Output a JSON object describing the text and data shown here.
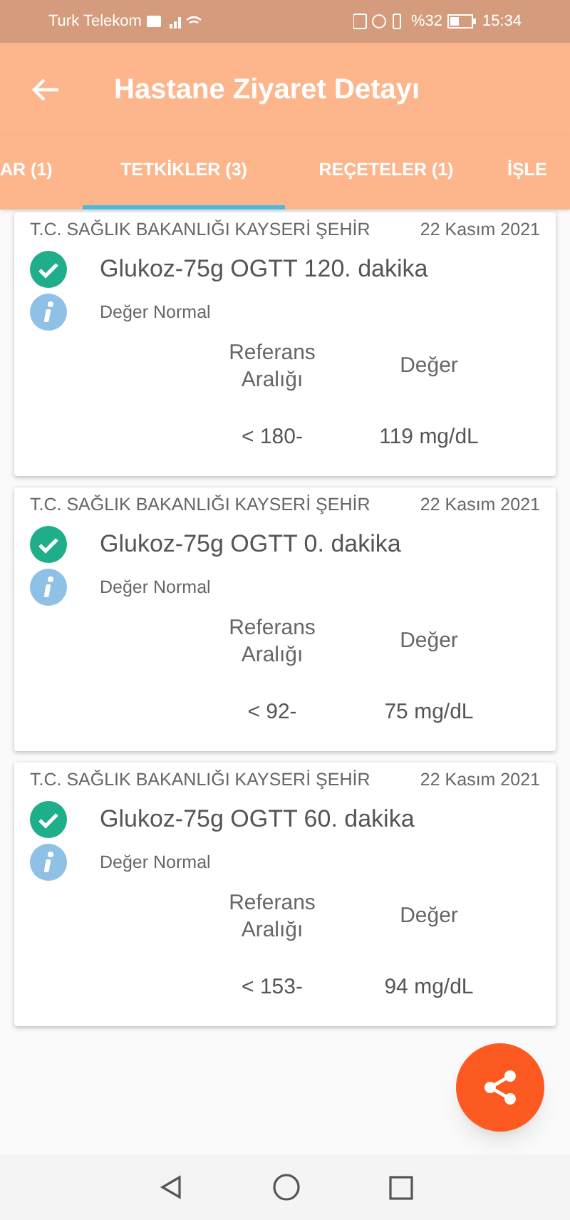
{
  "status_bar": {
    "carrier": "Turk Telekom",
    "battery": "%32",
    "time": "15:34"
  },
  "app_bar": {
    "title": "Hastane Ziyaret Detayı"
  },
  "tabs": [
    {
      "label": "AR (1)",
      "selected": false
    },
    {
      "label": "TETKİKLER (3)",
      "selected": true
    },
    {
      "label": "REÇETELER (1)",
      "selected": false
    },
    {
      "label": "İŞLE",
      "selected": false
    }
  ],
  "results": [
    {
      "hospital": "T.C. SAĞLIK BAKANLIĞI KAYSERİ ŞEHİR",
      "date": "22 Kasım 2021",
      "test": "Glukoz-75g OGTT 120. dakika",
      "status": "Değer Normal",
      "reference_header": "Referans Aralığı",
      "value_header": "Değer",
      "reference": "< 180-",
      "value": "119 mg/dL"
    },
    {
      "hospital": "T.C. SAĞLIK BAKANLIĞI KAYSERİ ŞEHİR",
      "date": "22 Kasım 2021",
      "test": "Glukoz-75g OGTT 0. dakika",
      "status": "Değer Normal",
      "reference_header": "Referans Aralığı",
      "value_header": "Değer",
      "reference": "< 92-",
      "value": "75 mg/dL"
    },
    {
      "hospital": "T.C. SAĞLIK BAKANLIĞI KAYSERİ ŞEHİR",
      "date": "22 Kasım 2021",
      "test": "Glukoz-75g OGTT 60. dakika",
      "status": "Değer Normal",
      "reference_header": "Referans Aralığı",
      "value_header": "Değer",
      "reference": "< 153-",
      "value": "94 mg/dL"
    }
  ]
}
